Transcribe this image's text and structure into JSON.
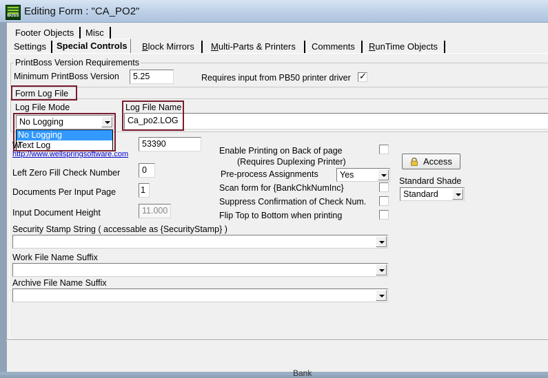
{
  "window": {
    "title": "Editing Form : \"CA_PO2\"",
    "icon": "printboss-app-icon",
    "icon_text": "BOSS",
    "behind_text": "Bank"
  },
  "tabs": {
    "row1": [
      {
        "label": "Footer Objects"
      },
      {
        "label": "Misc"
      }
    ],
    "row2": [
      {
        "label": "Settings"
      },
      {
        "label": "Special Controls",
        "selected": true
      },
      {
        "label_u": "B",
        "label_rest": "lock Mirrors"
      },
      {
        "label_u": "M",
        "label_rest": "ulti-Parts & Printers"
      },
      {
        "label": "Comments"
      },
      {
        "label_u": "R",
        "label_rest": "unTime Objects"
      }
    ]
  },
  "version_group": {
    "legend": "PrintBoss Version Requirements",
    "min_version_label": "Minimum PrintBoss Version",
    "min_version_value": "5.25",
    "requires_pb50_label": "Requires input from PB50 printer driver",
    "requires_pb50_checked": true
  },
  "log_group": {
    "legend": "Form Log File",
    "mode_label": "Log File Mode",
    "mode_value": "No Logging",
    "mode_options": [
      "No Logging",
      "Text Log"
    ],
    "name_label": "Log File Name",
    "name_value": "Ca_po2.LOG"
  },
  "left_fields": {
    "partial_label": "W",
    "partial_value": "53390",
    "website_link": "http://www.wellspringsoftware.com",
    "zero_fill_label": "Left Zero Fill Check Number",
    "zero_fill_value": "0",
    "docs_per_page_label": "Documents Per Input Page",
    "docs_per_page_value": "1",
    "input_height_label": "Input Document Height",
    "input_height_value": "11.000"
  },
  "right_fields": {
    "back_print_label": "Enable Printing on Back of page",
    "back_print_sub": "(Requires Duplexing Printer)",
    "preprocess_label": "Pre-process Assignments",
    "preprocess_value": "Yes",
    "scan_form_label": "Scan form for  {BankChkNumInc}",
    "suppress_label": "Suppress Confirmation of Check Num.",
    "flip_label": "Flip Top to Bottom when printing",
    "access_label": "Access",
    "shade_label": "Standard Shade",
    "shade_value": "Standard"
  },
  "bottom_fields": {
    "security_label": "Security Stamp String  ( accessable as  {SecurityStamp}    )",
    "security_value": "",
    "work_suffix_label": "Work File Name Suffix",
    "work_suffix_value": "",
    "archive_suffix_label": "Archive File Name Suffix",
    "archive_suffix_value": ""
  },
  "colors": {
    "highlight": "#7a1c2e",
    "selection": "#3399ff",
    "link": "#0000cc"
  }
}
